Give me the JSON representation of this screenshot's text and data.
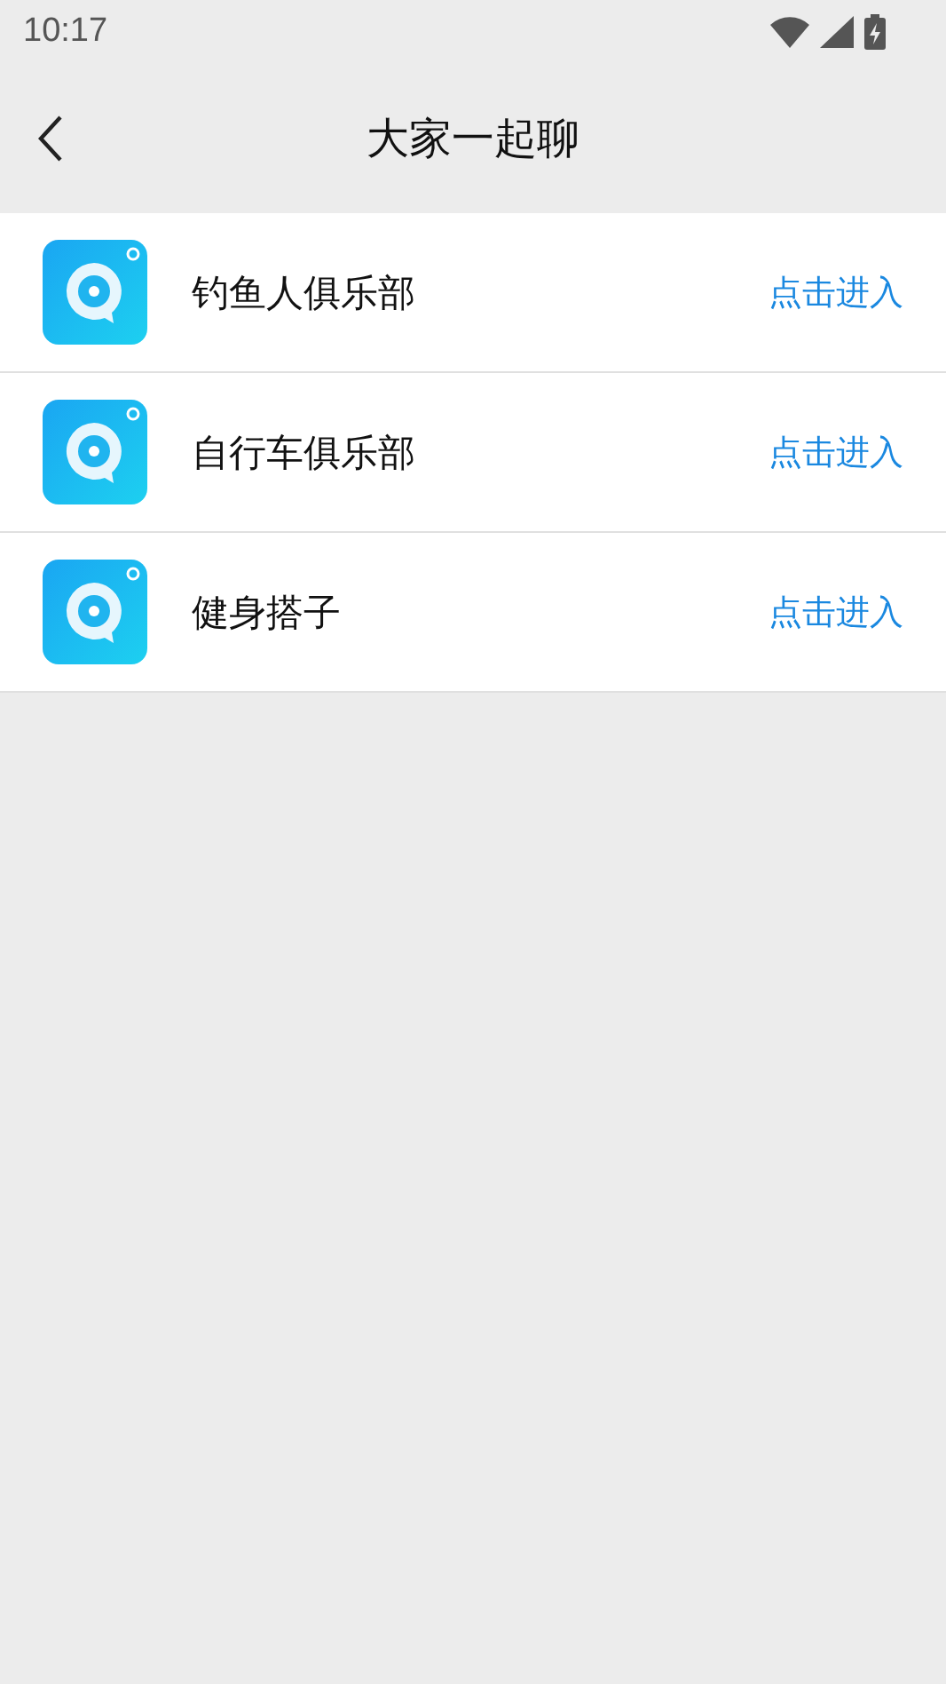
{
  "status_bar": {
    "time": "10:17"
  },
  "header": {
    "title": "大家一起聊"
  },
  "groups": [
    {
      "name": "钓鱼人俱乐部",
      "action": "点击进入"
    },
    {
      "name": "自行车俱乐部",
      "action": "点击进入"
    },
    {
      "name": "健身搭子",
      "action": "点击进入"
    }
  ]
}
